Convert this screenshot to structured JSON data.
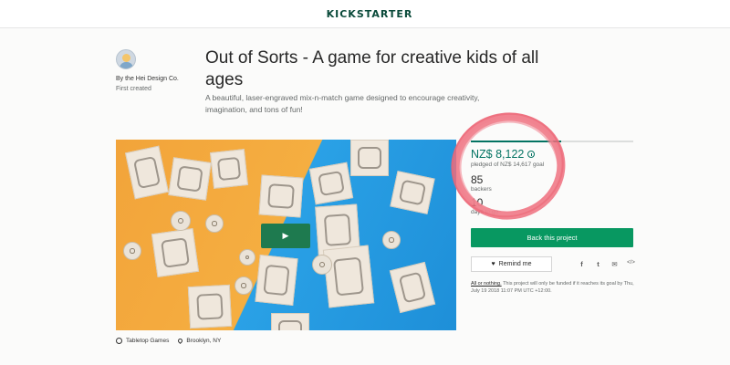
{
  "header": {
    "logo": "KICKSTARTER"
  },
  "creator": {
    "name": "By the Hei Design Co.",
    "sub": "First created"
  },
  "project": {
    "title": "Out of Sorts - A game for creative kids of all ages",
    "blurb": "A beautiful, laser-engraved mix-n-match game designed to encourage creativity, imagination, and tons of fun!"
  },
  "video": {
    "play_icon": "▶"
  },
  "stats": {
    "funded_fraction": 0.555,
    "pledged": "NZ$ 8,122",
    "goal_text": "pledged of NZ$ 14,617 goal",
    "backers": "85",
    "backers_label": "backers",
    "days": "10",
    "days_label": "days to go"
  },
  "actions": {
    "back_label": "Back this project",
    "remind_label": "Remind me",
    "share": {
      "facebook": "f",
      "twitter": "t",
      "email": "✉",
      "embed": "</>"
    }
  },
  "fine_print": {
    "link": "All or nothing.",
    "text": " This project will only be funded if it reaches its goal by Thu, July 19 2018 11:07 PM UTC +12:00."
  },
  "meta": {
    "category": "Tabletop Games",
    "location": "Brooklyn, NY"
  },
  "colors": {
    "accent_green": "#037362",
    "button_green": "#089861",
    "annotation": "#ef6d7c"
  }
}
